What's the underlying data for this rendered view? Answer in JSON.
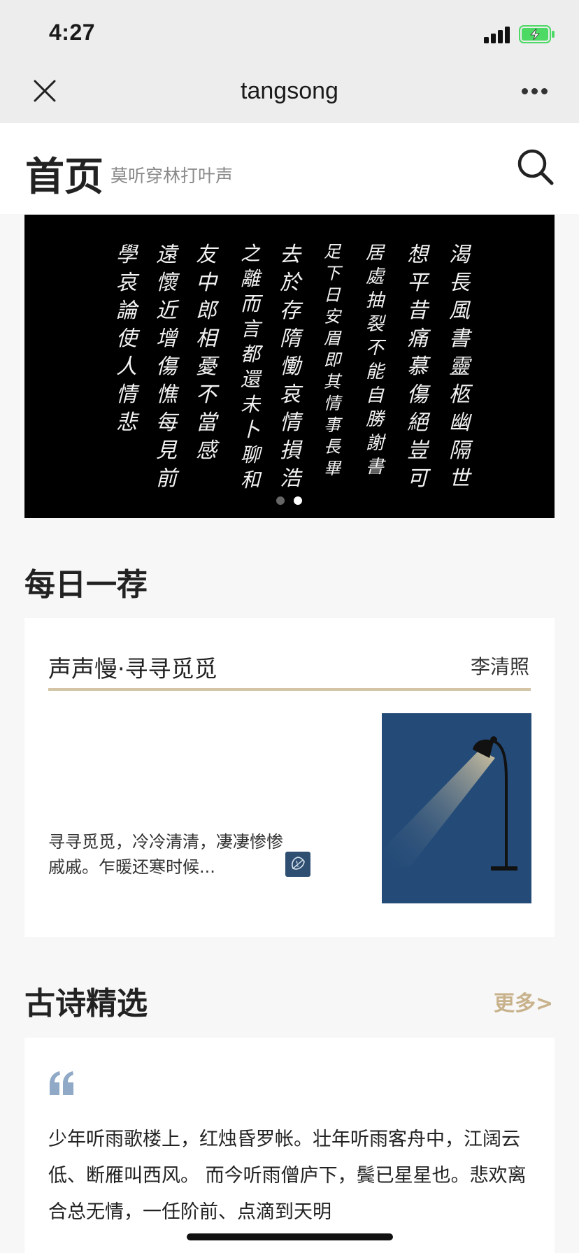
{
  "status_bar": {
    "time": "4:27"
  },
  "nav": {
    "title": "tangsong"
  },
  "header": {
    "title": "首页",
    "subtitle": "莫听穿林打叶声"
  },
  "banner": {
    "columns": [
      "渴長風書靈柩幽隔世",
      "想平昔痛慕傷絕豈可",
      "居處抽裂不能自勝謝書",
      "足下日安眉即其情事長畢",
      "去於存隋慟哀情損浩",
      "之離而言都還未卜聊和",
      "友中郎相憂不當感",
      "遠懷近增傷憔每見前",
      "學哀論使人情悲"
    ],
    "dots_total": 2,
    "dots_active_index": 1
  },
  "daily": {
    "section_title": "每日一荐",
    "poem_title": "声声慢·寻寻觅觅",
    "poem_author": "李清照",
    "excerpt": "寻寻觅觅，冷冷清清，凄凄惨惨戚戚。乍暖还寒时候...",
    "badge_icon": "leaf-icon",
    "image_icon": "desk-lamp-illustration"
  },
  "classics": {
    "section_title": "古诗精选",
    "more_label": "更多>",
    "quote_icon": "quote-icon",
    "quote_text": "少年听雨歌楼上，红烛昏罗帐。壮年听雨客舟中，江阔云低、断雁叫西风。 而今听雨僧庐下，鬓已星星也。悲欢离合总无情，一任阶前、点滴到天明"
  },
  "colors": {
    "accent_gold": "#c8b28c",
    "gold_line": "#d4c4a6",
    "lamp_bg": "#244b78",
    "quote_blue": "#8fa9c6",
    "battery_green": "#4cd964"
  }
}
